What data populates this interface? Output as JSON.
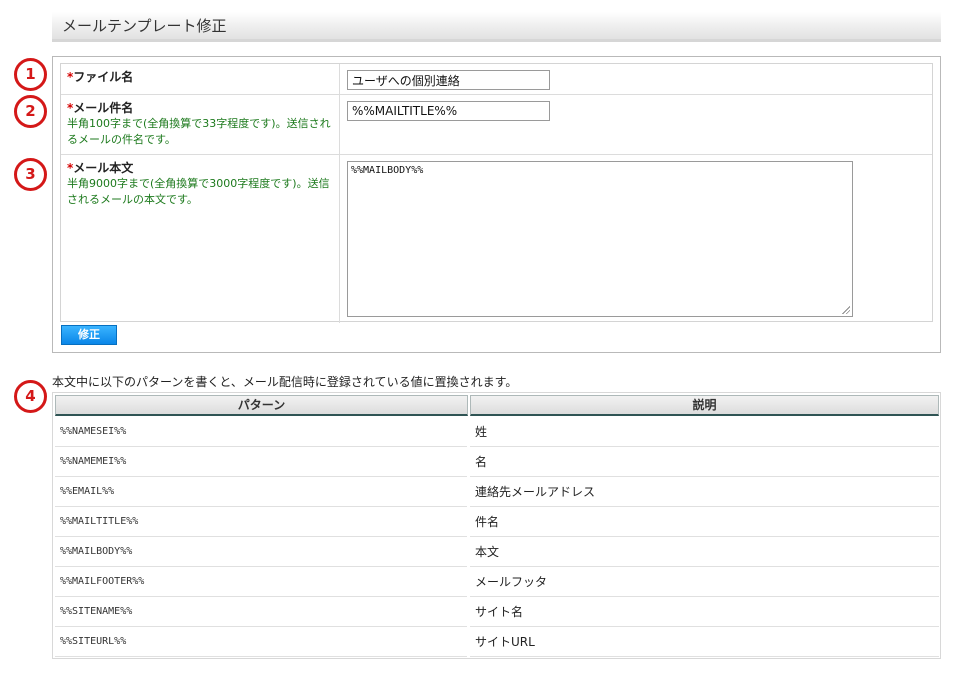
{
  "page": {
    "title": "メールテンプレート修正"
  },
  "form": {
    "filename": {
      "label": "ファイル名",
      "value": "ユーザへの個別連絡"
    },
    "subject": {
      "label": "メール件名",
      "hint": "半角100字まで(全角換算で33字程度です)。送信されるメールの件名です。",
      "value": "%%MAILTITLE%%"
    },
    "body": {
      "label": "メール本文",
      "hint": "半角9000字まで(全角換算で3000字程度です)。送信されるメールの本文です。",
      "value": "%%MAILBODY%%"
    },
    "required_mark": "*",
    "submit_label": "修正"
  },
  "markers": [
    "1",
    "2",
    "3",
    "4"
  ],
  "patterns": {
    "intro": "本文中に以下のパターンを書くと、メール配信時に登録されている値に置換されます。",
    "headers": [
      "パターン",
      "説明"
    ],
    "rows": [
      {
        "pattern": "%%NAMESEI%%",
        "desc": "姓"
      },
      {
        "pattern": "%%NAMEMEI%%",
        "desc": "名"
      },
      {
        "pattern": "%%EMAIL%%",
        "desc": "連絡先メールアドレス"
      },
      {
        "pattern": "%%MAILTITLE%%",
        "desc": "件名"
      },
      {
        "pattern": "%%MAILBODY%%",
        "desc": "本文"
      },
      {
        "pattern": "%%MAILFOOTER%%",
        "desc": "メールフッタ"
      },
      {
        "pattern": "%%SITENAME%%",
        "desc": "サイト名"
      },
      {
        "pattern": "%%SITEURL%%",
        "desc": "サイトURL"
      }
    ]
  },
  "colors": {
    "required": "#d40000",
    "hint": "#1d7a1d",
    "marker": "#d41818",
    "button": "#0a86e8"
  }
}
